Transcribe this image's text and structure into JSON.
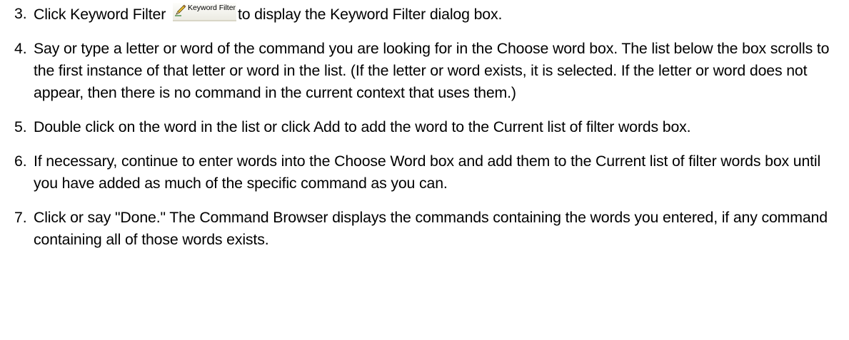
{
  "steps": [
    {
      "number": "3.",
      "before": "Click Keyword Filter ",
      "button_label": "Keyword Filter",
      "button_icon": "pencil-icon",
      "after": "to display the Keyword Filter dialog box."
    },
    {
      "number": "4.",
      "text": "Say or type a letter or word of the command you are looking for in the Choose word box. The list below the box scrolls to the first instance of that letter or word in the list. (If the letter or word exists, it is selected. If the letter or word does not appear, then there is no command in the current context that uses them.)"
    },
    {
      "number": "5.",
      "text": "Double click on the word in the list or click Add to add the word to the Current list of filter words box."
    },
    {
      "number": "6.",
      "text": "If necessary, continue to enter words into the Choose Word box and add them to the Current list of filter words box until you have added as much of the specific command as you can."
    },
    {
      "number": "7.",
      "text": "Click or say \"Done.\" The Command Browser displays the commands containing the words you entered, if any command containing all of those words exists."
    }
  ]
}
